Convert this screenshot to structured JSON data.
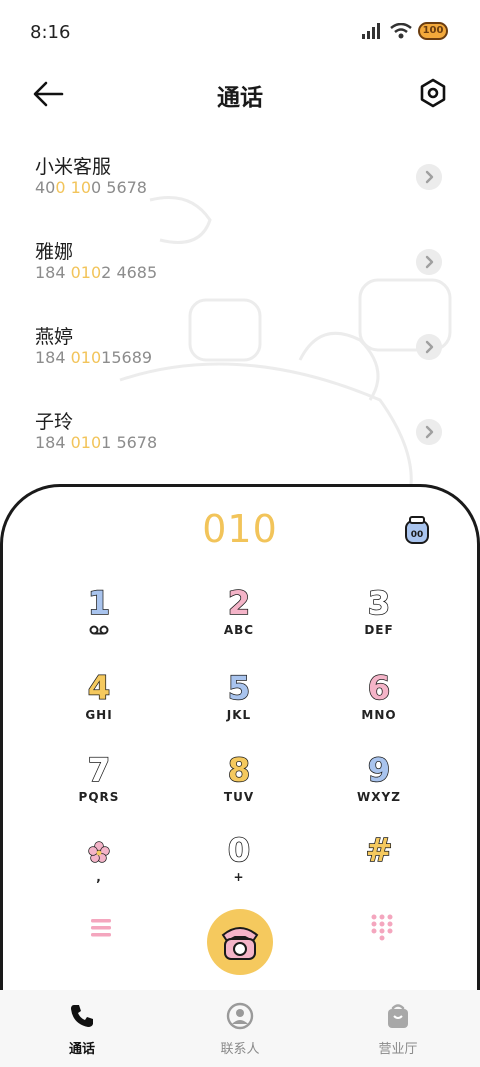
{
  "status_bar": {
    "time": "8:16",
    "battery": "100"
  },
  "header": {
    "title": "通话"
  },
  "contacts": [
    {
      "name": "小米客服",
      "number_parts": [
        "40",
        "0",
        " ",
        "10",
        "0 5678"
      ]
    },
    {
      "name": "雅娜",
      "number_parts": [
        "184 ",
        "010",
        "",
        "",
        "2 4685"
      ]
    },
    {
      "name": "燕婷",
      "number_parts": [
        "184 ",
        "010",
        "",
        "",
        "15689"
      ]
    },
    {
      "name": "子玲",
      "number_parts": [
        "184 ",
        "010",
        "",
        "",
        "1 5678"
      ]
    }
  ],
  "dialpad": {
    "input": "010",
    "keys": [
      {
        "digit": "1",
        "letters": "",
        "color": "#a9c4ee"
      },
      {
        "digit": "2",
        "letters": "ABC",
        "color": "#f4b4c8"
      },
      {
        "digit": "3",
        "letters": "DEF",
        "color": "#ffffff"
      },
      {
        "digit": "4",
        "letters": "GHI",
        "color": "#f5c95e"
      },
      {
        "digit": "5",
        "letters": "JKL",
        "color": "#a9c4ee"
      },
      {
        "digit": "6",
        "letters": "MNO",
        "color": "#f4b4c8"
      },
      {
        "digit": "7",
        "letters": "PQRS",
        "color": "#ffffff"
      },
      {
        "digit": "8",
        "letters": "TUV",
        "color": "#f5c95e"
      },
      {
        "digit": "9",
        "letters": "WXYZ",
        "color": "#a9c4ee"
      },
      {
        "digit": "",
        "letters": ",",
        "color": "#f4b4c8"
      },
      {
        "digit": "0",
        "letters": "+",
        "color": "#ffffff"
      },
      {
        "digit": "#",
        "letters": "",
        "color": "#f5c95e"
      }
    ]
  },
  "bottom_nav": [
    {
      "label": "通话",
      "active": true
    },
    {
      "label": "联系人",
      "active": false
    },
    {
      "label": "营业厅",
      "active": false
    }
  ],
  "colors": {
    "accent": "#f2c45a",
    "pink": "#f4b4c8",
    "blue": "#a9c4ee"
  }
}
